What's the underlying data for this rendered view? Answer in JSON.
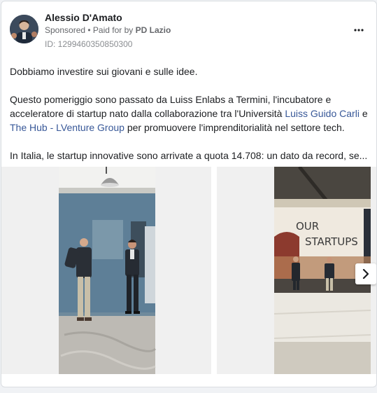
{
  "post": {
    "author": "Alessio D'Amato",
    "sponsored": "Sponsored",
    "paid_prefix": "• Paid for by",
    "paid_by": "PD Lazio",
    "id": "ID: 1299460350850300",
    "more_icon": "more-horizontal-icon",
    "text": {
      "line1": "Dobbiamo investire sui giovani e sulle idee.",
      "para2_start": "Questo pomeriggio sono passato da Luiss Enlabs a Termini, l'incubatore e acceleratore di startup nato dalla collaborazione tra l'Università ",
      "link1": "Luiss Guido Carli",
      "para2_mid": " e ",
      "link2": "The Hub - LVenture Group",
      "para2_end": " per promuovere l'imprenditorialità nel settore tech.",
      "para3": "In Italia, le startup innovative sono arrivate a quota 14.708: un dato da record, se..."
    }
  },
  "carousel": {
    "slides": [
      {
        "label": "photo-office-two-men"
      },
      {
        "label": "photo-our-startups",
        "wall_text": "OUR STARTUPS"
      }
    ],
    "next_icon": "chevron-right-icon"
  },
  "colors": {
    "link": "#385898",
    "meta": "#65676b",
    "card_bg": "#ffffff",
    "page_bg": "#f0f2f5"
  }
}
